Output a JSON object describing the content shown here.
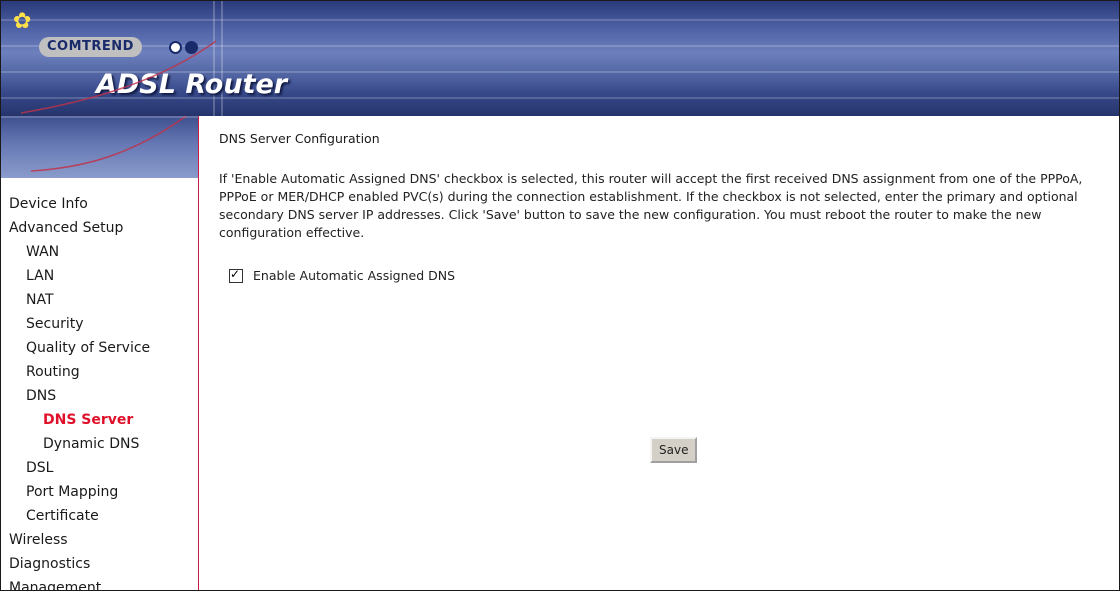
{
  "header": {
    "brand": "COMTREND",
    "product": "ADSL Router",
    "colors": {
      "banner": "#4f63a6",
      "brand_dot_1": "#ffffff",
      "brand_dot_2": "#1a2b6b"
    }
  },
  "sidebar": {
    "items": [
      {
        "label": "Device Info",
        "level": 1,
        "active": false
      },
      {
        "label": "Advanced Setup",
        "level": 1,
        "active": false
      },
      {
        "label": "WAN",
        "level": 2,
        "active": false
      },
      {
        "label": "LAN",
        "level": 2,
        "active": false
      },
      {
        "label": "NAT",
        "level": 2,
        "active": false
      },
      {
        "label": "Security",
        "level": 2,
        "active": false
      },
      {
        "label": "Quality of Service",
        "level": 2,
        "active": false
      },
      {
        "label": "Routing",
        "level": 2,
        "active": false
      },
      {
        "label": "DNS",
        "level": 2,
        "active": false
      },
      {
        "label": "DNS Server",
        "level": 3,
        "active": true
      },
      {
        "label": "Dynamic DNS",
        "level": 3,
        "active": false
      },
      {
        "label": "DSL",
        "level": 2,
        "active": false
      },
      {
        "label": "Port Mapping",
        "level": 2,
        "active": false
      },
      {
        "label": "Certificate",
        "level": 2,
        "active": false
      },
      {
        "label": "Wireless",
        "level": 1,
        "active": false
      },
      {
        "label": "Diagnostics",
        "level": 1,
        "active": false
      },
      {
        "label": "Management",
        "level": 1,
        "active": false
      }
    ],
    "active_color": "#e0102a"
  },
  "main": {
    "title": "DNS Server Configuration",
    "description": "If 'Enable Automatic Assigned DNS' checkbox is selected, this router will accept the first received DNS assignment from one of the PPPoA, PPPoE or MER/DHCP enabled PVC(s) during the connection establishment. If the checkbox is not selected, enter the primary and optional secondary DNS server IP addresses. Click 'Save' button to save the new configuration. You must reboot the router to make the new configuration effective.",
    "auto_dns": {
      "label": "Enable Automatic Assigned DNS",
      "checked": true
    },
    "save_label": "Save"
  }
}
